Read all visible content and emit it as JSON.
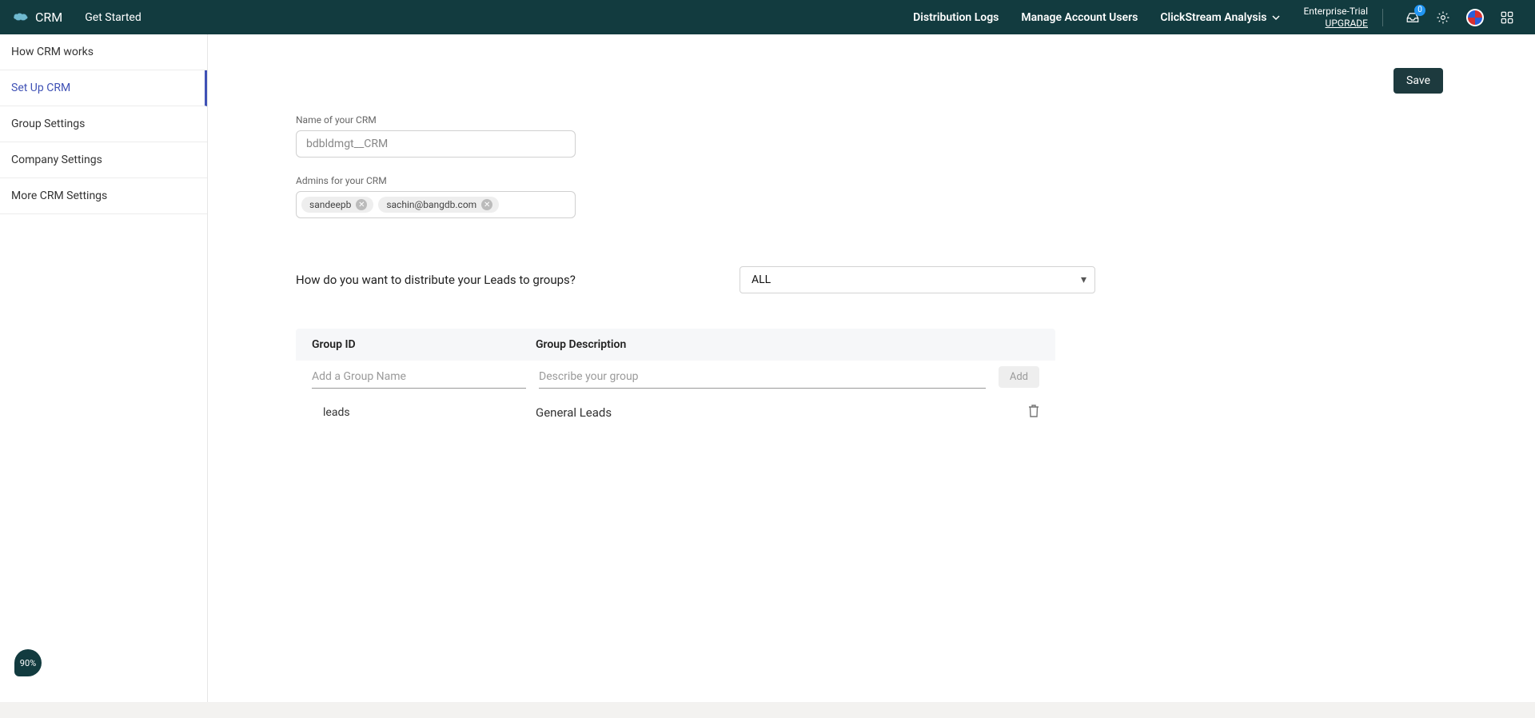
{
  "header": {
    "app_title": "CRM",
    "get_started": "Get Started",
    "nav": {
      "distribution_logs": "Distribution Logs",
      "manage_users": "Manage Account Users",
      "clickstream": "ClickStream Analysis"
    },
    "trial": {
      "name": "Enterprise-Trial",
      "upgrade": "UPGRADE"
    },
    "notif_count": "0"
  },
  "sidebar": {
    "items": [
      "How CRM works",
      "Set Up CRM",
      "Group Settings",
      "Company Settings",
      "More CRM Settings"
    ],
    "active_index": 1
  },
  "main": {
    "save_label": "Save",
    "crm_name_label": "Name of your CRM",
    "crm_name_placeholder": "bdbldmgt__CRM",
    "admins_label": "Admins for your CRM",
    "admin_chips": [
      "sandeepb",
      "sachin@bangdb.com"
    ],
    "distribute_q": "How do you want to distribute your Leads to groups?",
    "distribute_value": "ALL",
    "groups": {
      "head_id": "Group ID",
      "head_desc": "Group Description",
      "input_id_placeholder": "Add a Group Name",
      "input_desc_placeholder": "Describe your group",
      "add_label": "Add",
      "rows": [
        {
          "id": "leads",
          "desc": "General Leads"
        }
      ]
    }
  },
  "progress": "90%"
}
